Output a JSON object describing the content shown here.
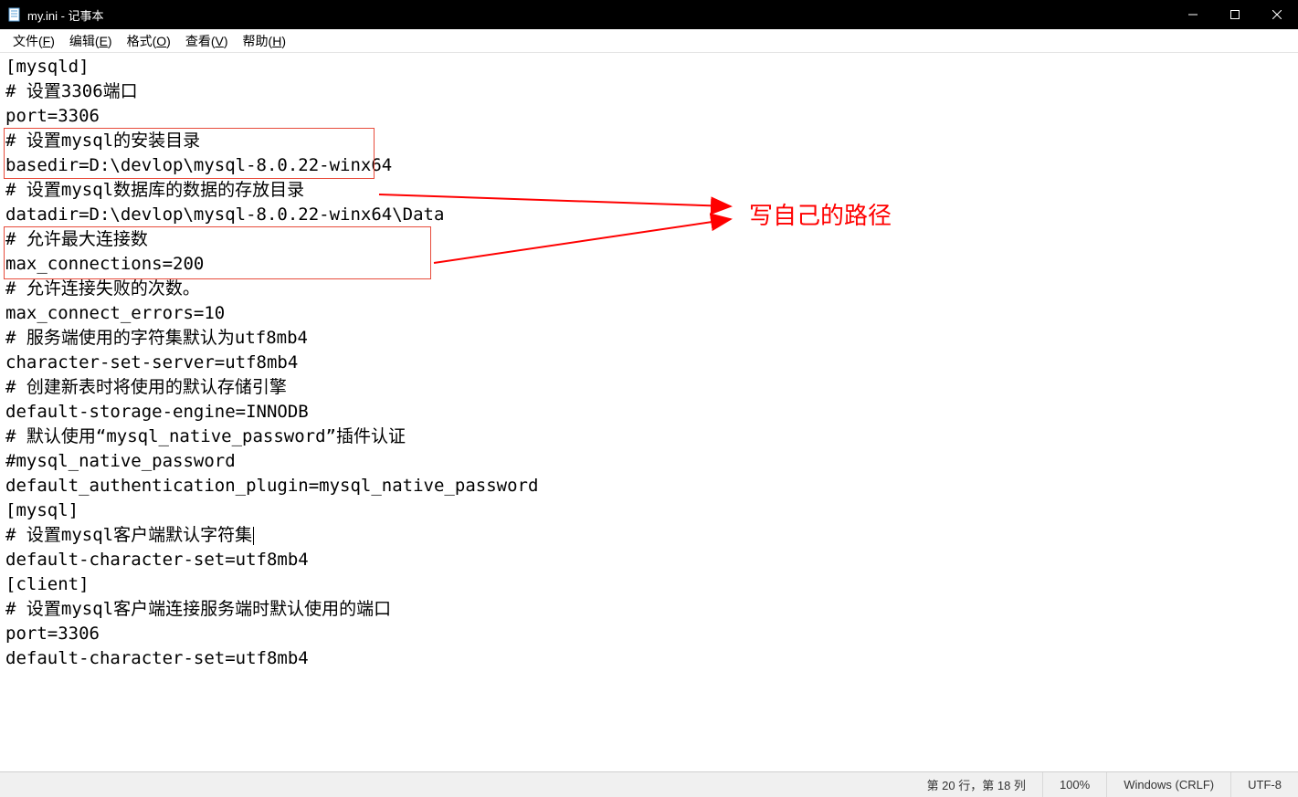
{
  "window": {
    "title": "my.ini - 记事本",
    "icon_name": "notepad-icon"
  },
  "menu": {
    "file": {
      "label": "文件",
      "accel": "F"
    },
    "edit": {
      "label": "编辑",
      "accel": "E"
    },
    "format": {
      "label": "格式",
      "accel": "O"
    },
    "view": {
      "label": "查看",
      "accel": "V"
    },
    "help": {
      "label": "帮助",
      "accel": "H"
    }
  },
  "content": {
    "lines": [
      "[mysqld]",
      "# 设置3306端口",
      "port=3306",
      "# 设置mysql的安装目录",
      "basedir=D:\\devlop\\mysql-8.0.22-winx64",
      "# 设置mysql数据库的数据的存放目录",
      "datadir=D:\\devlop\\mysql-8.0.22-winx64\\Data",
      "# 允许最大连接数",
      "max_connections=200",
      "# 允许连接失败的次数。",
      "max_connect_errors=10",
      "# 服务端使用的字符集默认为utf8mb4",
      "character-set-server=utf8mb4",
      "# 创建新表时将使用的默认存储引擎",
      "default-storage-engine=INNODB",
      "# 默认使用“mysql_native_password”插件认证",
      "#mysql_native_password",
      "default_authentication_plugin=mysql_native_password",
      "[mysql]",
      "# 设置mysql客户端默认字符集",
      "default-character-set=utf8mb4",
      "[client]",
      "# 设置mysql客户端连接服务端时默认使用的端口",
      "port=3306",
      "default-character-set=utf8mb4"
    ]
  },
  "annotation": {
    "text": "写自己的路径"
  },
  "statusbar": {
    "position": "第 20 行，第 18 列",
    "zoom": "100%",
    "line_ending": "Windows (CRLF)",
    "encoding": "UTF-8"
  }
}
